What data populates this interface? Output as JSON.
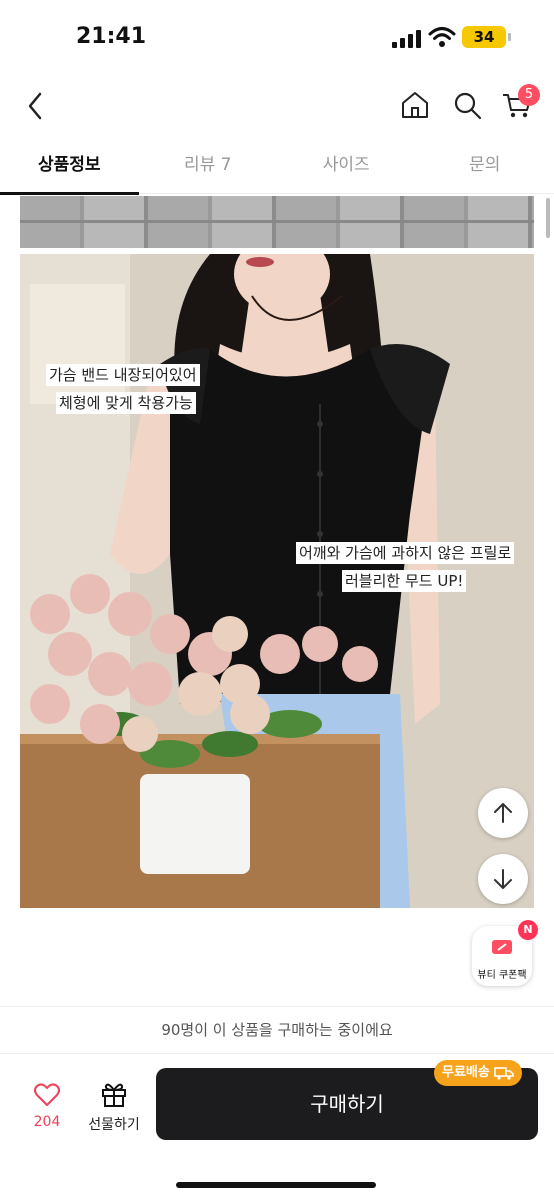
{
  "status_bar": {
    "time": "21:41",
    "battery": "34"
  },
  "nav": {
    "cart_count": "5"
  },
  "tabs": [
    {
      "label": "상품정보",
      "active": true
    },
    {
      "label": "리뷰 7",
      "active": false
    },
    {
      "label": "사이즈",
      "active": false
    },
    {
      "label": "문의",
      "active": false
    }
  ],
  "captions": {
    "caption1_line1": "가슴 밴드 내장되어있어",
    "caption1_line2": "체형에 맞게 착용가능",
    "caption2_line1": "어깨와 가슴에 과하지 않은 프릴로",
    "caption2_line2": "러블리한 무드 UP!"
  },
  "coupon": {
    "label": "뷰티 쿠폰팩",
    "badge": "N"
  },
  "notice": "90명이 이 상품을 구매하는 중이에요",
  "bottom_bar": {
    "like_count": "204",
    "gift_label": "선물하기",
    "buy_label": "구매하기",
    "free_ship_label": "무료배송"
  },
  "colors": {
    "accent": "#ff4d62",
    "buy_button": "#1c1c1e",
    "free_ship": "#f7a21b"
  }
}
